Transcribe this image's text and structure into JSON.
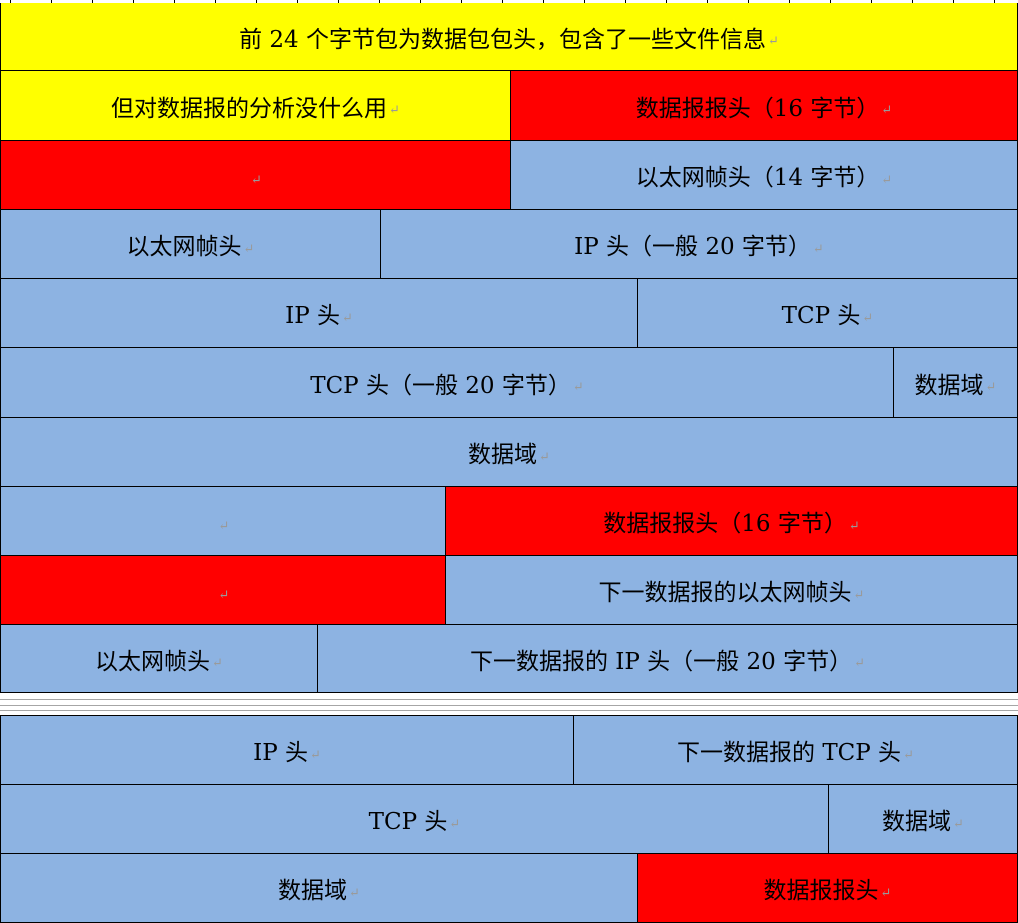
{
  "mark": "↵",
  "rows": [
    {
      "cells": [
        {
          "text": "前 24 个字节包为数据包包头，包含了一些文件信息",
          "color": "yellow"
        }
      ]
    },
    {
      "cells": [
        {
          "text": "但对数据报的分析没什么用",
          "color": "yellow"
        },
        {
          "text": "数据报报头（16 字节）",
          "color": "red"
        }
      ]
    },
    {
      "cells": [
        {
          "text": "",
          "color": "red"
        },
        {
          "text": "以太网帧头（14 字节）",
          "color": "blue"
        }
      ]
    },
    {
      "cells": [
        {
          "text": "以太网帧头",
          "color": "blue"
        },
        {
          "text": "IP 头（一般 20 字节）",
          "color": "blue"
        }
      ]
    },
    {
      "cells": [
        {
          "text": "IP 头",
          "color": "blue"
        },
        {
          "text": "TCP 头",
          "color": "blue"
        }
      ]
    },
    {
      "cells": [
        {
          "text": "TCP 头（一般 20 字节）",
          "color": "blue"
        },
        {
          "text": "数据域",
          "color": "blue"
        }
      ]
    },
    {
      "cells": [
        {
          "text": "数据域",
          "color": "blue"
        }
      ]
    },
    {
      "cells": [
        {
          "text": "",
          "color": "blue"
        },
        {
          "text": "数据报报头（16 字节）",
          "color": "red"
        }
      ]
    },
    {
      "cells": [
        {
          "text": "",
          "color": "red"
        },
        {
          "text": "下一数据报的以太网帧头",
          "color": "blue"
        }
      ]
    },
    {
      "cells": [
        {
          "text": "以太网帧头",
          "color": "blue"
        },
        {
          "text": "下一数据报的 IP 头（一般 20 字节）",
          "color": "blue"
        }
      ]
    },
    {
      "cells": [
        {
          "text": "IP 头",
          "color": "blue"
        },
        {
          "text": "下一数据报的 TCP 头",
          "color": "blue"
        }
      ]
    },
    {
      "cells": [
        {
          "text": "TCP 头",
          "color": "blue"
        },
        {
          "text": "数据域",
          "color": "blue"
        }
      ]
    },
    {
      "cells": [
        {
          "text": "数据域",
          "color": "blue"
        },
        {
          "text": "数据报报头",
          "color": "red"
        }
      ]
    }
  ],
  "colors": {
    "yellow": "#ffff00",
    "red": "#ff0000",
    "blue": "#8db3e2"
  }
}
